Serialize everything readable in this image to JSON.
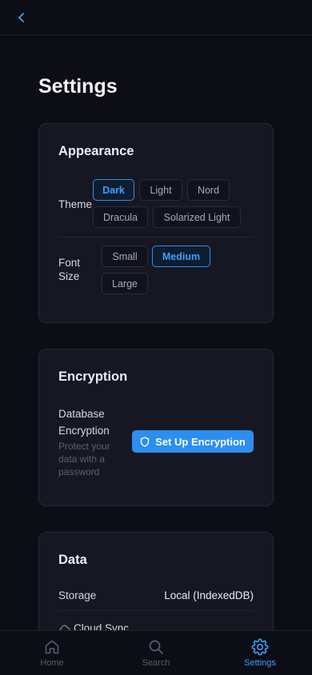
{
  "page": {
    "title": "Settings"
  },
  "colors": {
    "accent": "#2c8ef2",
    "background": "#0d0e15",
    "card": "#161722"
  },
  "appearance": {
    "title": "Appearance",
    "theme_label": "Theme",
    "themes": [
      "Dark",
      "Light",
      "Nord",
      "Dracula",
      "Solarized Light"
    ],
    "selected_theme": "Dark",
    "font_size_label": "Font Size",
    "font_sizes": [
      "Small",
      "Medium",
      "Large"
    ],
    "selected_font_size": "Medium"
  },
  "encryption": {
    "title": "Encryption",
    "label": "Database Encryption",
    "description": "Protect your data with a password",
    "button_label": "Set Up Encryption",
    "button_icon": "shield-icon"
  },
  "data": {
    "title": "Data",
    "storage_label": "Storage",
    "storage_value": "Local (IndexedDB)",
    "cloud_sync_label": "Cloud Sync",
    "cloud_sync_icon": "cloud-icon"
  },
  "nav": {
    "items": [
      {
        "label": "Home",
        "icon": "home-icon"
      },
      {
        "label": "Search",
        "icon": "search-icon"
      },
      {
        "label": "Settings",
        "icon": "gear-icon"
      }
    ],
    "active": "Settings"
  }
}
